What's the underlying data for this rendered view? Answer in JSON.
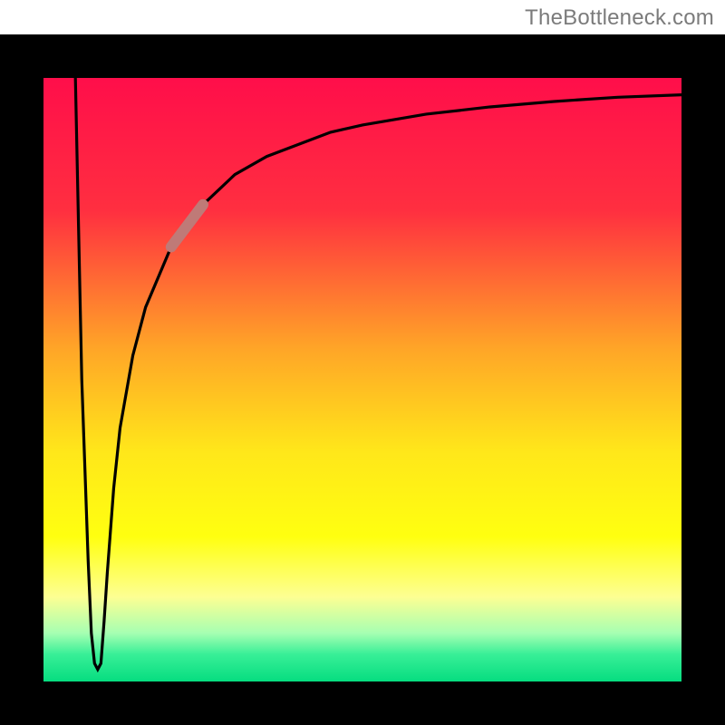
{
  "attribution": "TheBottleneck.com",
  "chart_data": {
    "type": "line",
    "title": "",
    "xlabel": "",
    "ylabel": "",
    "xlim": [
      0,
      100
    ],
    "ylim": [
      0,
      100
    ],
    "grid": false,
    "series": [
      {
        "name": "curve",
        "x": [
          5,
          6,
          7,
          7.5,
          8,
          8.5,
          9,
          9.5,
          10,
          10.5,
          11,
          12,
          14,
          16,
          20,
          25,
          30,
          35,
          40,
          45,
          50,
          60,
          70,
          80,
          90,
          100
        ],
        "y": [
          100,
          50,
          20,
          8,
          3,
          2,
          3,
          10,
          18,
          25,
          32,
          42,
          54,
          62,
          72,
          79,
          84,
          87,
          89,
          91,
          92.2,
          94,
          95.2,
          96.1,
          96.8,
          97.2
        ]
      }
    ],
    "highlight_segment": {
      "x": [
        20,
        25
      ],
      "y": [
        72,
        79
      ]
    },
    "background_gradient": {
      "stops": [
        {
          "offset": 0.0,
          "color": "#ff0e4a"
        },
        {
          "offset": 0.22,
          "color": "#ff2f40"
        },
        {
          "offset": 0.45,
          "color": "#ffa627"
        },
        {
          "offset": 0.62,
          "color": "#ffe71a"
        },
        {
          "offset": 0.76,
          "color": "#ffff10"
        },
        {
          "offset": 0.86,
          "color": "#fdff93"
        },
        {
          "offset": 0.92,
          "color": "#a6ffb2"
        },
        {
          "offset": 0.955,
          "color": "#38ef97"
        },
        {
          "offset": 1.0,
          "color": "#06dd80"
        }
      ]
    },
    "frame_color": "#000000",
    "frame_thickness_px": 48
  }
}
